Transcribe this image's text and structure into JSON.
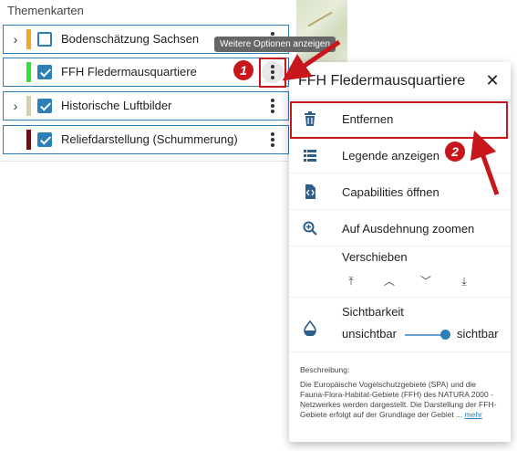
{
  "panel": {
    "title": "Themenkarten",
    "layers": [
      {
        "label": "Bodenschätzung Sachsen",
        "expandable": true,
        "checked": false,
        "color": "#f5a623"
      },
      {
        "label": "FFH Fledermausquartiere",
        "expandable": false,
        "checked": true,
        "color": "#2fe62f"
      },
      {
        "label": "Historische Luftbilder",
        "expandable": true,
        "checked": true,
        "color": "#d9cfa8"
      },
      {
        "label": "Reliefdarstellung (Schummerung)",
        "expandable": false,
        "checked": true,
        "color": "#7a0b0b"
      }
    ],
    "expander_glyph": "›"
  },
  "tooltip": {
    "text": "Weitere Optionen anzeigen"
  },
  "menu": {
    "title": "FFH Fledermausquartiere",
    "close_glyph": "✕",
    "items": {
      "remove": "Entfernen",
      "legend": "Legende anzeigen",
      "capabilities": "Capabilities öffnen",
      "zoom": "Auf Ausdehnung zoomen"
    },
    "move": {
      "label": "Verschieben",
      "top": "⤒",
      "up": "︿",
      "down": "﹀",
      "bottom": "⤓"
    },
    "visibility": {
      "label": "Sichtbarkeit",
      "min": "unsichtbar",
      "max": "sichtbar",
      "value": 1.0
    },
    "description": {
      "title": "Beschreibung:",
      "text": "Die Europäische Vogelschutzgebiete (SPA) und die Fauna-Flora-Habitat-Gebiete (FFH) des NATURA 2000 - Netzwerkes werden dargestellt. Die Darstellung der FFH-Gebiete erfolgt auf der Grundlage der Gebiet ...",
      "more": "mehr"
    }
  },
  "annotations": {
    "step1": "1",
    "step2": "2",
    "color": "#c8161d"
  },
  "colors": {
    "accent": "#2d7fb8"
  }
}
